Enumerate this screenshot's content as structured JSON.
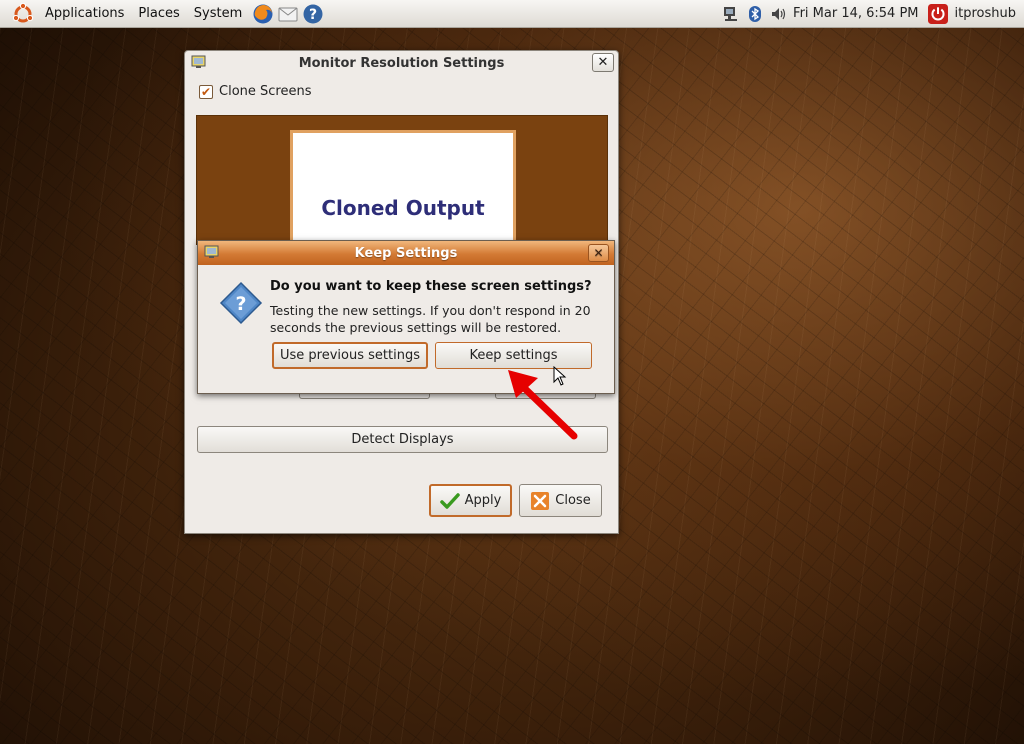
{
  "panel": {
    "menus": [
      "Applications",
      "Places",
      "System"
    ],
    "clock": "Fri Mar 14,  6:54 PM",
    "username": "itproshub",
    "icons": [
      "ubuntu-logo",
      "firefox-icon",
      "mail-icon",
      "help-icon",
      "network-icon",
      "bluetooth-icon",
      "volume-icon",
      "power-icon"
    ]
  },
  "main_window": {
    "title": "Monitor Resolution Settings",
    "clone_checkbox_label": "Clone Screens",
    "clone_checked": true,
    "monitor_label": "Cloned Output",
    "detect_button": "Detect Displays",
    "apply_button": "Apply",
    "close_button": "Close"
  },
  "keep_dialog": {
    "title": "Keep Settings",
    "heading": "Do you want to keep these screen settings?",
    "body": "Testing the new settings. If you don't respond in 20 seconds the previous settings will be restored.",
    "previous_button": "Use previous settings",
    "keep_button": "Keep settings"
  },
  "colors": {
    "accent": "#c16a2a",
    "title_gradient_top": "#f1b77c",
    "title_gradient_bottom": "#c0631f",
    "monitor_bg": "#7a4210",
    "arrow": "#e60000"
  }
}
